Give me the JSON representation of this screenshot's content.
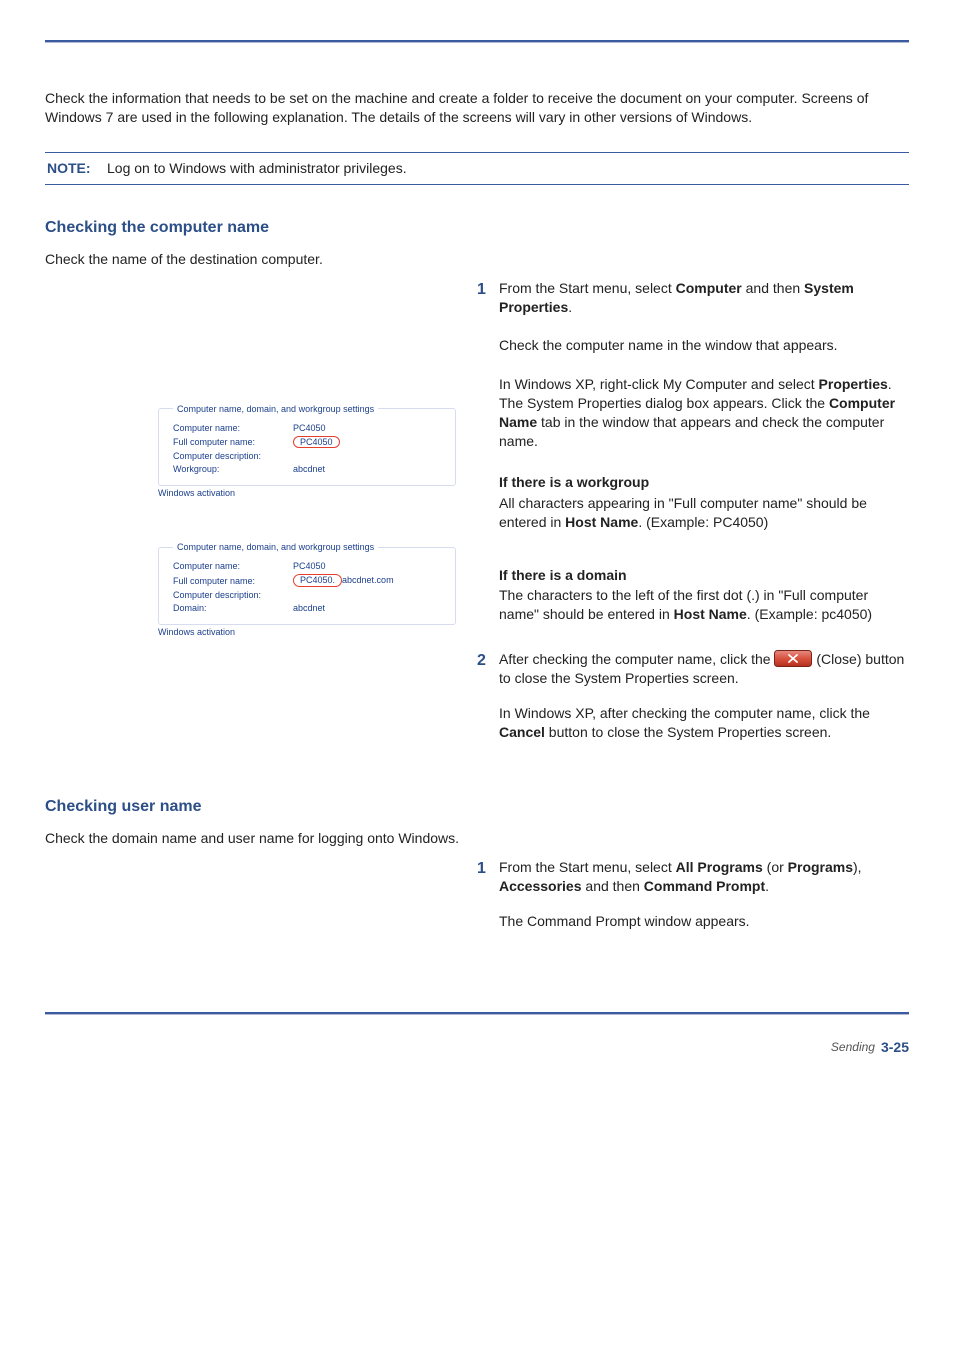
{
  "intro": "Check the information that needs to be set on the machine and create a folder to receive the document on your computer. Screens of Windows 7 are used in the following explanation. The details of the screens will vary in other versions of Windows.",
  "note_label": "NOTE:",
  "note_text": "Log on to Windows with administrator privileges.",
  "sec1_title": "Checking the computer name",
  "sec1_desc": "Check the name of the destination computer.",
  "s1_num": "1",
  "s1_a": "From the Start menu, select ",
  "s1_b": "Computer",
  "s1_c": " and then ",
  "s1_b2": "System Properties",
  "s1_d": ".",
  "s1_e": "Check the computer name in the window that appears.",
  "s1_f1": "In Windows XP, right-click My Computer and select ",
  "s1_f2": "Properties",
  "s1_f3": ". The System Properties dialog box appears. Click the ",
  "s1_f4": "Computer Name",
  "s1_f5": " tab in the window that appears and check the computer name.",
  "branch1_title": "If there is a workgroup",
  "branch1_a": "All characters appearing in \"Full computer name\" should be entered in ",
  "branch1_b": "Host Name",
  "branch1_c": ". (Example: PC4050)",
  "branch2_title": "If there is a domain",
  "branch2_a": "The characters to the left of the first dot (.) in \"Full computer name\" should be entered in ",
  "branch2_b": "Host Name",
  "branch2_c": ". (Example: pc4050)",
  "s2_num": "2",
  "s2_a": "After checking the computer name, click the ",
  "s2_b": " (Close) button to close the System Properties screen.",
  "s2_c1": "In Windows XP, after checking the computer name, click the ",
  "s2_c2": "Cancel",
  "s2_c3": " button to close the System Properties screen.",
  "sec2_title": "Checking user name",
  "sec2_desc": "Check the domain name and user name for logging onto Windows.",
  "s3_num": "1",
  "s3_a": "From the Start menu, select ",
  "s3_b": "All Programs",
  "s3_c": " (or ",
  "s3_d": "Programs",
  "s3_e": "), ",
  "s3_f": "Accessories",
  "s3_g": " and then ",
  "s3_h": "Command Prompt",
  "s3_i": ".",
  "s3_j": "The Command Prompt window appears.",
  "sysbox_legend": "Computer name, domain, and workgroup settings",
  "sysbox_k1": "Computer name:",
  "sysbox_v1a": "PC4050",
  "sysbox_k2": "Full computer name:",
  "sysbox_v2a": "PC4050",
  "sysbox_k3": "Computer description:",
  "sysbox_k4w": "Workgroup:",
  "sysbox_v4w": "abcdnet",
  "sysbox_v1b": "PC4050",
  "sysbox_v2b_circ": "PC4050.",
  "sysbox_v2b_rest": "abcdnet.com",
  "sysbox_k4d": "Domain:",
  "sysbox_v4d": "abcdnet",
  "sysbox_trailing": "Windows activation",
  "footer_text": "Sending",
  "footer_page": "3-25"
}
